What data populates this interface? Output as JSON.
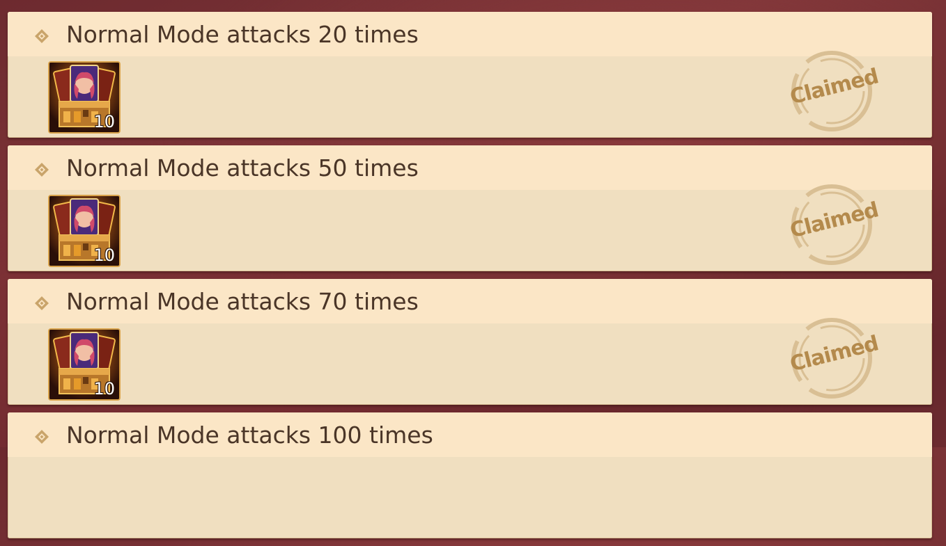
{
  "tasks": [
    {
      "title": "Normal Mode attacks 20 times",
      "reward_icon": "hero-card-chest-icon",
      "reward_quantity": "10",
      "status": "Claimed"
    },
    {
      "title": "Normal Mode attacks 50 times",
      "reward_icon": "hero-card-chest-icon",
      "reward_quantity": "10",
      "status": "Claimed"
    },
    {
      "title": "Normal Mode attacks 70 times",
      "reward_icon": "hero-card-chest-icon",
      "reward_quantity": "10",
      "status": "Claimed"
    },
    {
      "title": "Normal Mode attacks 100 times"
    }
  ],
  "colors": {
    "background": "#6d2a2f",
    "card": "#f0dfc0",
    "header": "#fbe6c6",
    "title_text": "#4a3527",
    "stamp": "#b48a4c",
    "bullet": "#c9a46a"
  }
}
